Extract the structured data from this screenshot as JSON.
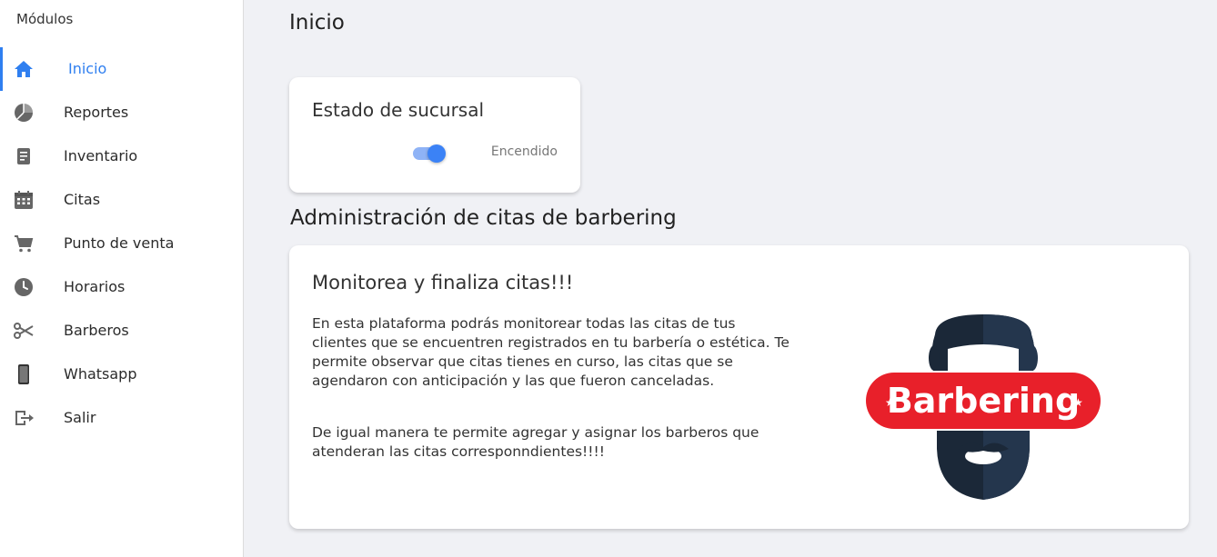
{
  "sidebar": {
    "header": "Módulos",
    "items": [
      {
        "label": "Inicio",
        "icon": "home-icon",
        "active": true
      },
      {
        "label": "Reportes",
        "icon": "pie-chart-icon"
      },
      {
        "label": "Inventario",
        "icon": "document-icon"
      },
      {
        "label": "Citas",
        "icon": "calendar-icon"
      },
      {
        "label": "Punto de venta",
        "icon": "cart-icon"
      },
      {
        "label": "Horarios",
        "icon": "clock-icon"
      },
      {
        "label": "Barberos",
        "icon": "scissors-icon"
      },
      {
        "label": "Whatsapp",
        "icon": "phone-icon"
      },
      {
        "label": "Salir",
        "icon": "exit-icon"
      }
    ]
  },
  "main": {
    "title": "Inicio",
    "status_card": {
      "title": "Estado de sucursal",
      "toggle_on": true,
      "status_label": "Encendido"
    },
    "section_title": "Administración de citas de barbering",
    "info_card": {
      "title": "Monitorea y finaliza citas!!!",
      "paragraph_1": "En esta plataforma podrás monitorear todas las citas de tus clientes que se encuentren registrados en tu barbería o estética. Te permite observar que citas tienes en curso, las citas que se agendaron con anticipación y las que fueron canceladas.",
      "paragraph_2": "De igual manera te permite agregar y asignar los barberos que atenderan las citas corresponndientes!!!!",
      "logo_text": "Barbering"
    }
  },
  "colors": {
    "accent": "#2f7ff0",
    "logo_red": "#e8202a",
    "logo_navy": "#1b2838"
  }
}
